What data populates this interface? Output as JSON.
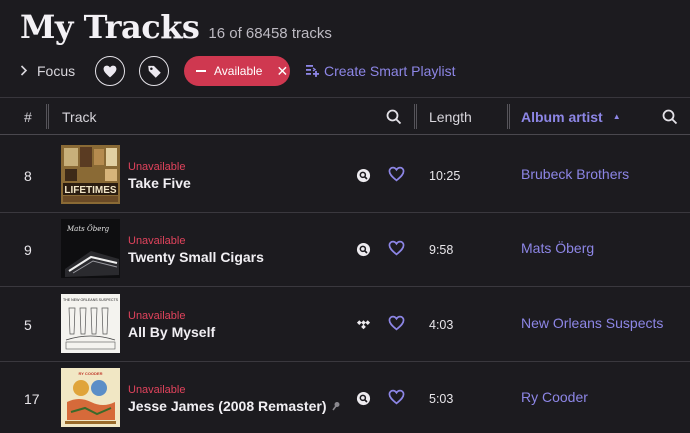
{
  "header": {
    "title": "My Tracks",
    "count": "16 of 68458 tracks"
  },
  "toolbar": {
    "focus_label": "Focus",
    "filter_chip_label": "Available",
    "smart_playlist_label": "Create Smart Playlist"
  },
  "columns": {
    "number": "#",
    "track": "Track",
    "length": "Length",
    "album_artist": "Album artist"
  },
  "colors": {
    "accent": "#8d86e6",
    "unavailable": "#e0435c",
    "chip": "#cf3850",
    "background": "#1c1b1f"
  },
  "rows": [
    {
      "number": "8",
      "status": "Unavailable",
      "title": "Take Five",
      "source_icon": "search-source-icon",
      "length": "10:25",
      "album_artist": "Brubeck Brothers",
      "art_text": "LIFETIMES"
    },
    {
      "number": "9",
      "status": "Unavailable",
      "title": "Twenty Small Cigars",
      "source_icon": "search-source-icon",
      "length": "9:58",
      "album_artist": "Mats Öberg",
      "art_text": "Mats Öberg"
    },
    {
      "number": "5",
      "status": "Unavailable",
      "title": "All By Myself",
      "source_icon": "tidal-icon",
      "length": "4:03",
      "album_artist": "New Orleans Suspects",
      "art_text": "THE NEW ORLEANS SUSPECTS"
    },
    {
      "number": "17",
      "status": "Unavailable",
      "title": "Jesse James (2008 Remaster)",
      "source_icon": "search-source-icon",
      "length": "5:03",
      "album_artist": "Ry Cooder",
      "art_text": "RY COODER"
    }
  ]
}
